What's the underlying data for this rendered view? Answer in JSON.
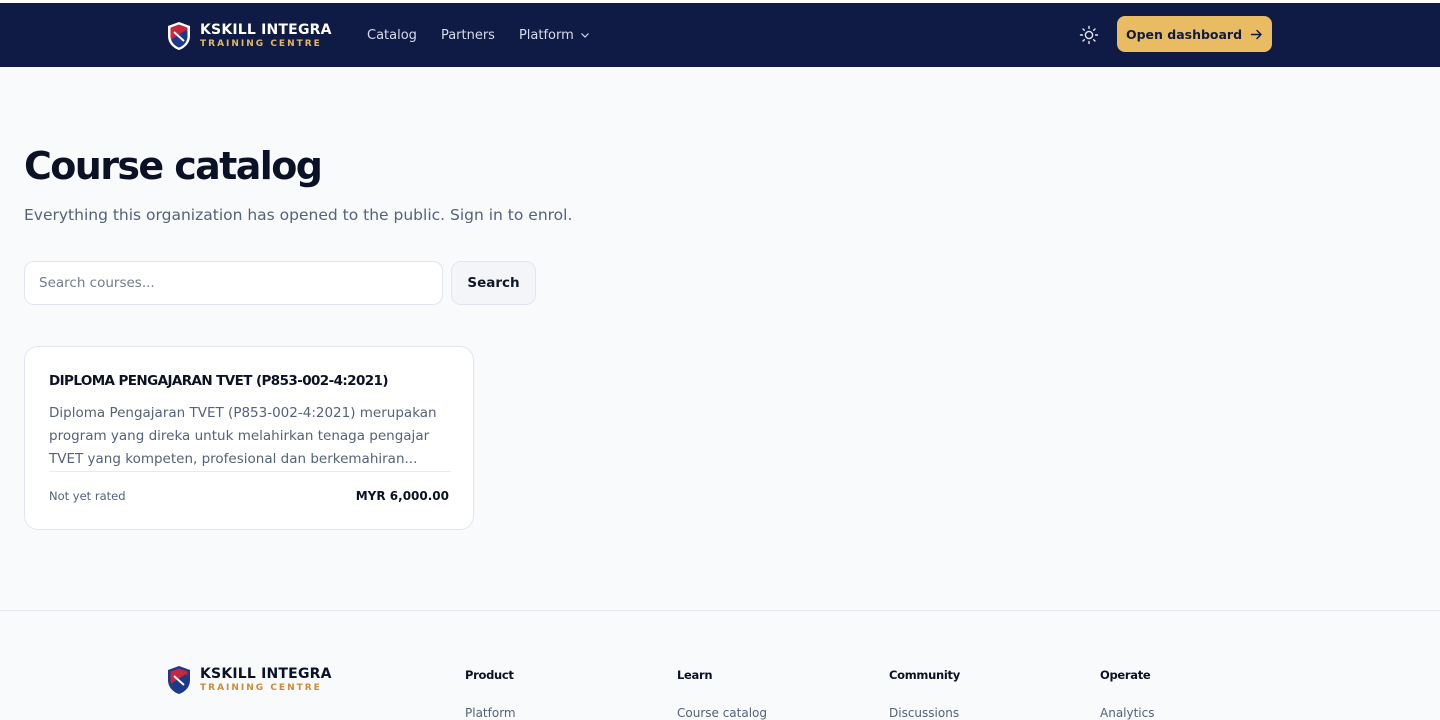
{
  "navbar": {
    "brand_name": "KSKILL INTEGRA",
    "brand_sub": "TRAINING CENTRE",
    "links": [
      {
        "label": "Catalog"
      },
      {
        "label": "Partners"
      },
      {
        "label": "Platform"
      }
    ],
    "theme_icon": "sun-icon",
    "cta_label": "Open dashboard",
    "colors": {
      "bg": "#0f1b45",
      "accent": "#e9bc63"
    }
  },
  "main": {
    "title": "Course catalog",
    "subtitle": "Everything this organization has opened to the public. Sign in to enrol.",
    "search": {
      "placeholder": "Search courses...",
      "value": "",
      "button_label": "Search"
    },
    "courses": [
      {
        "title": "DIPLOMA PENGAJARAN TVET (P853-002-4:2021)",
        "description": "Diploma Pengajaran TVET (P853-002-4:2021) merupakan program yang direka untuk melahirkan tenaga pengajar TVET yang kompeten, profesional dan berkemahiran...",
        "rating": "Not yet rated",
        "price": "MYR 6,000.00"
      }
    ]
  },
  "footer": {
    "brand_name": "KSKILL INTEGRA",
    "brand_sub": "TRAINING CENTRE",
    "columns": [
      {
        "heading": "Product",
        "first_link": "Platform"
      },
      {
        "heading": "Learn",
        "first_link": "Course catalog"
      },
      {
        "heading": "Community",
        "first_link": "Discussions"
      },
      {
        "heading": "Operate",
        "first_link": "Analytics"
      }
    ]
  }
}
